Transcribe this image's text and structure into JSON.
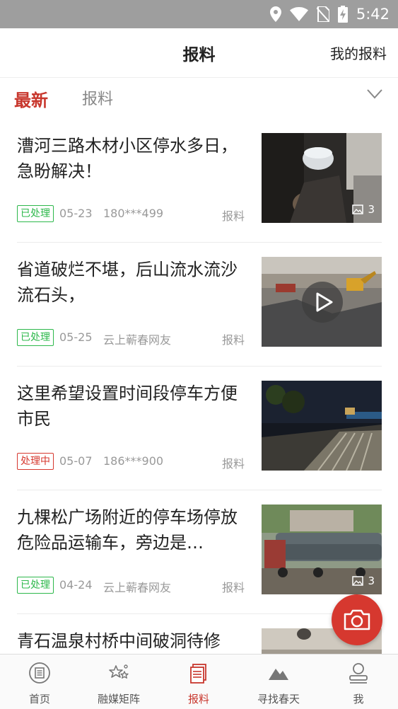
{
  "status_bar": {
    "time": "5:42"
  },
  "header": {
    "title": "报料",
    "action": "我的报料"
  },
  "tabs": {
    "active": "最新",
    "inactive": "报料"
  },
  "feed": [
    {
      "title": "漕河三路木材小区停水多日，急盼解决！",
      "status": "已处理",
      "date": "05-23",
      "user": "180***499",
      "category": "报料",
      "image_count": "3",
      "media": "image"
    },
    {
      "title": "省道破烂不堪，后山流水流沙流石头，",
      "status": "已处理",
      "date": "05-25",
      "user": "云上蕲春网友",
      "category": "报料",
      "media": "video"
    },
    {
      "title": "这里希望设置时间段停车方便市民",
      "status": "处理中",
      "date": "05-07",
      "user": "186***900",
      "category": "报料",
      "media": "image"
    },
    {
      "title": "九棵松广场附近的停车场停放危险品运输车，旁边是…",
      "status": "已处理",
      "date": "04-24",
      "user": "云上蕲春网友",
      "category": "报料",
      "image_count": "3",
      "media": "image"
    },
    {
      "title": "青石温泉村桥中间破洞待修",
      "media": "image"
    }
  ],
  "bottom_nav": [
    {
      "label": "首页",
      "icon": "newspaper-icon"
    },
    {
      "label": "融媒矩阵",
      "icon": "stars-icon"
    },
    {
      "label": "报料",
      "icon": "report-icon"
    },
    {
      "label": "寻找春天",
      "icon": "mountain-icon"
    },
    {
      "label": "我",
      "icon": "person-icon"
    }
  ],
  "colors": {
    "accent": "#c8372d",
    "done": "#2db84b",
    "doing": "#d6382f",
    "status_bar": "#9e9e9e"
  }
}
